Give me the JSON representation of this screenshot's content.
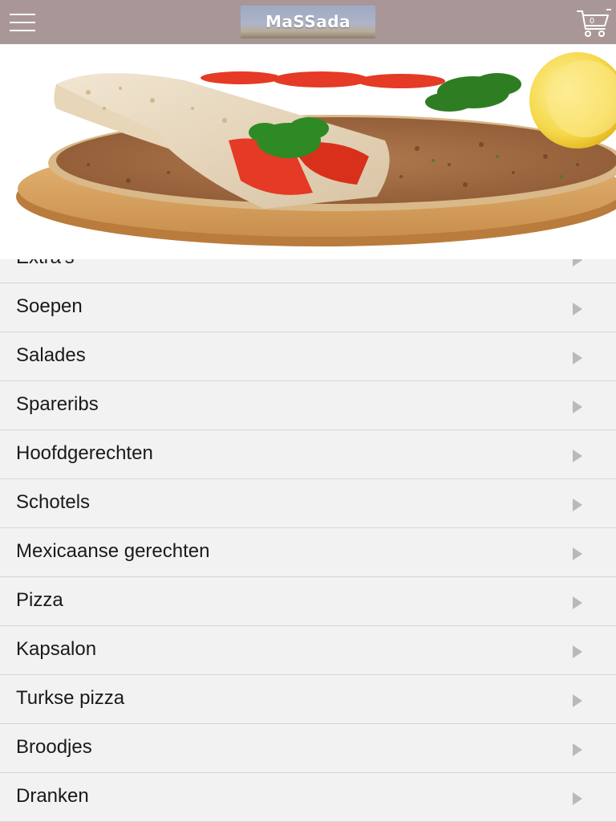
{
  "header": {
    "menu_icon": "hamburger-menu-icon",
    "logo_text": "MaSSada",
    "cart_icon": "shopping-cart-icon",
    "cart_count": "0",
    "background_color": "#a99797"
  },
  "banner": {
    "image": "lahmacun-wrap-with-tomato-parsley-and-lemon-on-wooden-board"
  },
  "categories": [
    {
      "label": "Extra's"
    },
    {
      "label": "Soepen"
    },
    {
      "label": "Salades"
    },
    {
      "label": "Spareribs"
    },
    {
      "label": "Hoofdgerechten"
    },
    {
      "label": "Schotels"
    },
    {
      "label": "Mexicaanse gerechten"
    },
    {
      "label": "Pizza"
    },
    {
      "label": "Kapsalon"
    },
    {
      "label": "Turkse pizza"
    },
    {
      "label": "Broodjes"
    },
    {
      "label": "Dranken"
    }
  ],
  "row_arrow_icon": "chevron-right-icon"
}
